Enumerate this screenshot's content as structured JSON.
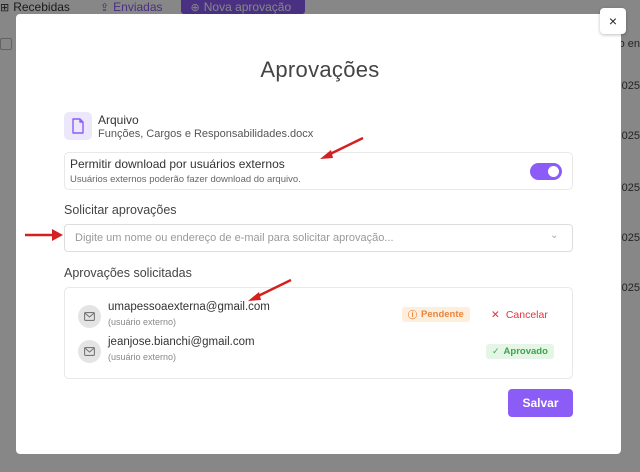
{
  "background": {
    "tabs": [
      {
        "label": "Recebidas",
        "icon": "plus-square-icon"
      },
      {
        "label": "Enviadas",
        "icon": "upload-icon"
      },
      {
        "label": "Nova aprovação",
        "icon": "plus-circle-icon"
      }
    ],
    "column_header": "o en",
    "row_dates": [
      "025",
      "025",
      "025",
      "025",
      "025"
    ]
  },
  "modal": {
    "close_label": "×",
    "title": "Aprovações",
    "file": {
      "label": "Arquivo",
      "name": "Funções, Cargos e Responsabilidades.docx",
      "icon": "document-icon"
    },
    "permission": {
      "title": "Permitir download por usuários externos",
      "subtitle": "Usuários externos poderão fazer download do arquivo.",
      "enabled": true
    },
    "request": {
      "label": "Solicitar aprovações",
      "placeholder": "Digite um nome ou endereço de e-mail para solicitar aprovação..."
    },
    "requested": {
      "label": "Aprovações solicitadas",
      "items": [
        {
          "email": "umapessoaexterna@gmail.com",
          "type": "(usuário externo)",
          "status": "Pendente",
          "status_icon": "question-circle-icon",
          "action": "Cancelar"
        },
        {
          "email": "jeanjose.bianchi@gmail.com",
          "type": "(usuário externo)",
          "status": "Aprovado",
          "status_icon": "check-circle-icon",
          "action": ""
        }
      ]
    },
    "save_label": "Salvar"
  },
  "colors": {
    "accent": "#8b5cf6",
    "pending": "#e8863a",
    "approved": "#3aa64a",
    "cancel": "#e0353c",
    "annotation_arrow": "#d42020"
  }
}
